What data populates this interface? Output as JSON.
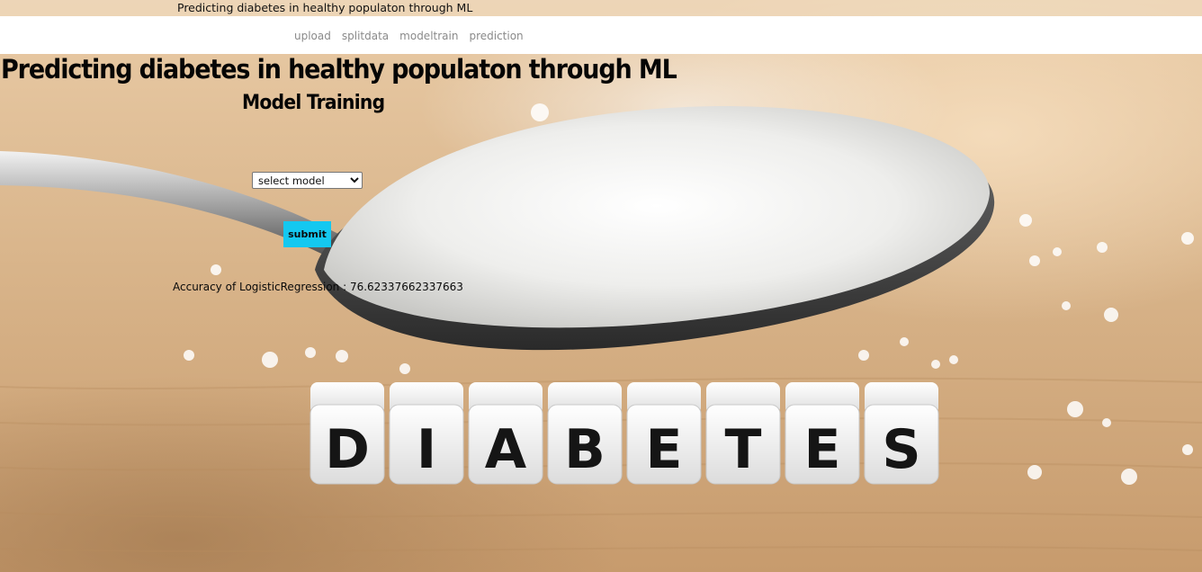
{
  "window": {
    "title": "Predicting diabetes in healthy populaton through ML"
  },
  "nav": {
    "items": [
      {
        "label": "upload"
      },
      {
        "label": "splitdata"
      },
      {
        "label": "modeltrain"
      },
      {
        "label": "prediction"
      }
    ]
  },
  "main": {
    "heading": "Predicting diabetes in healthy populaton through ML",
    "subheading": "Model Training",
    "select": {
      "selected": "select model"
    },
    "submit_label": "submit",
    "result_text": "Accuracy of LogisticRegression : 76.62337662337663"
  },
  "background": {
    "block_letters": "DIABETES",
    "colors": {
      "wood": "#d9b58b",
      "sugar": "#f4f4f2",
      "button_accent": "#14c8f0"
    }
  }
}
